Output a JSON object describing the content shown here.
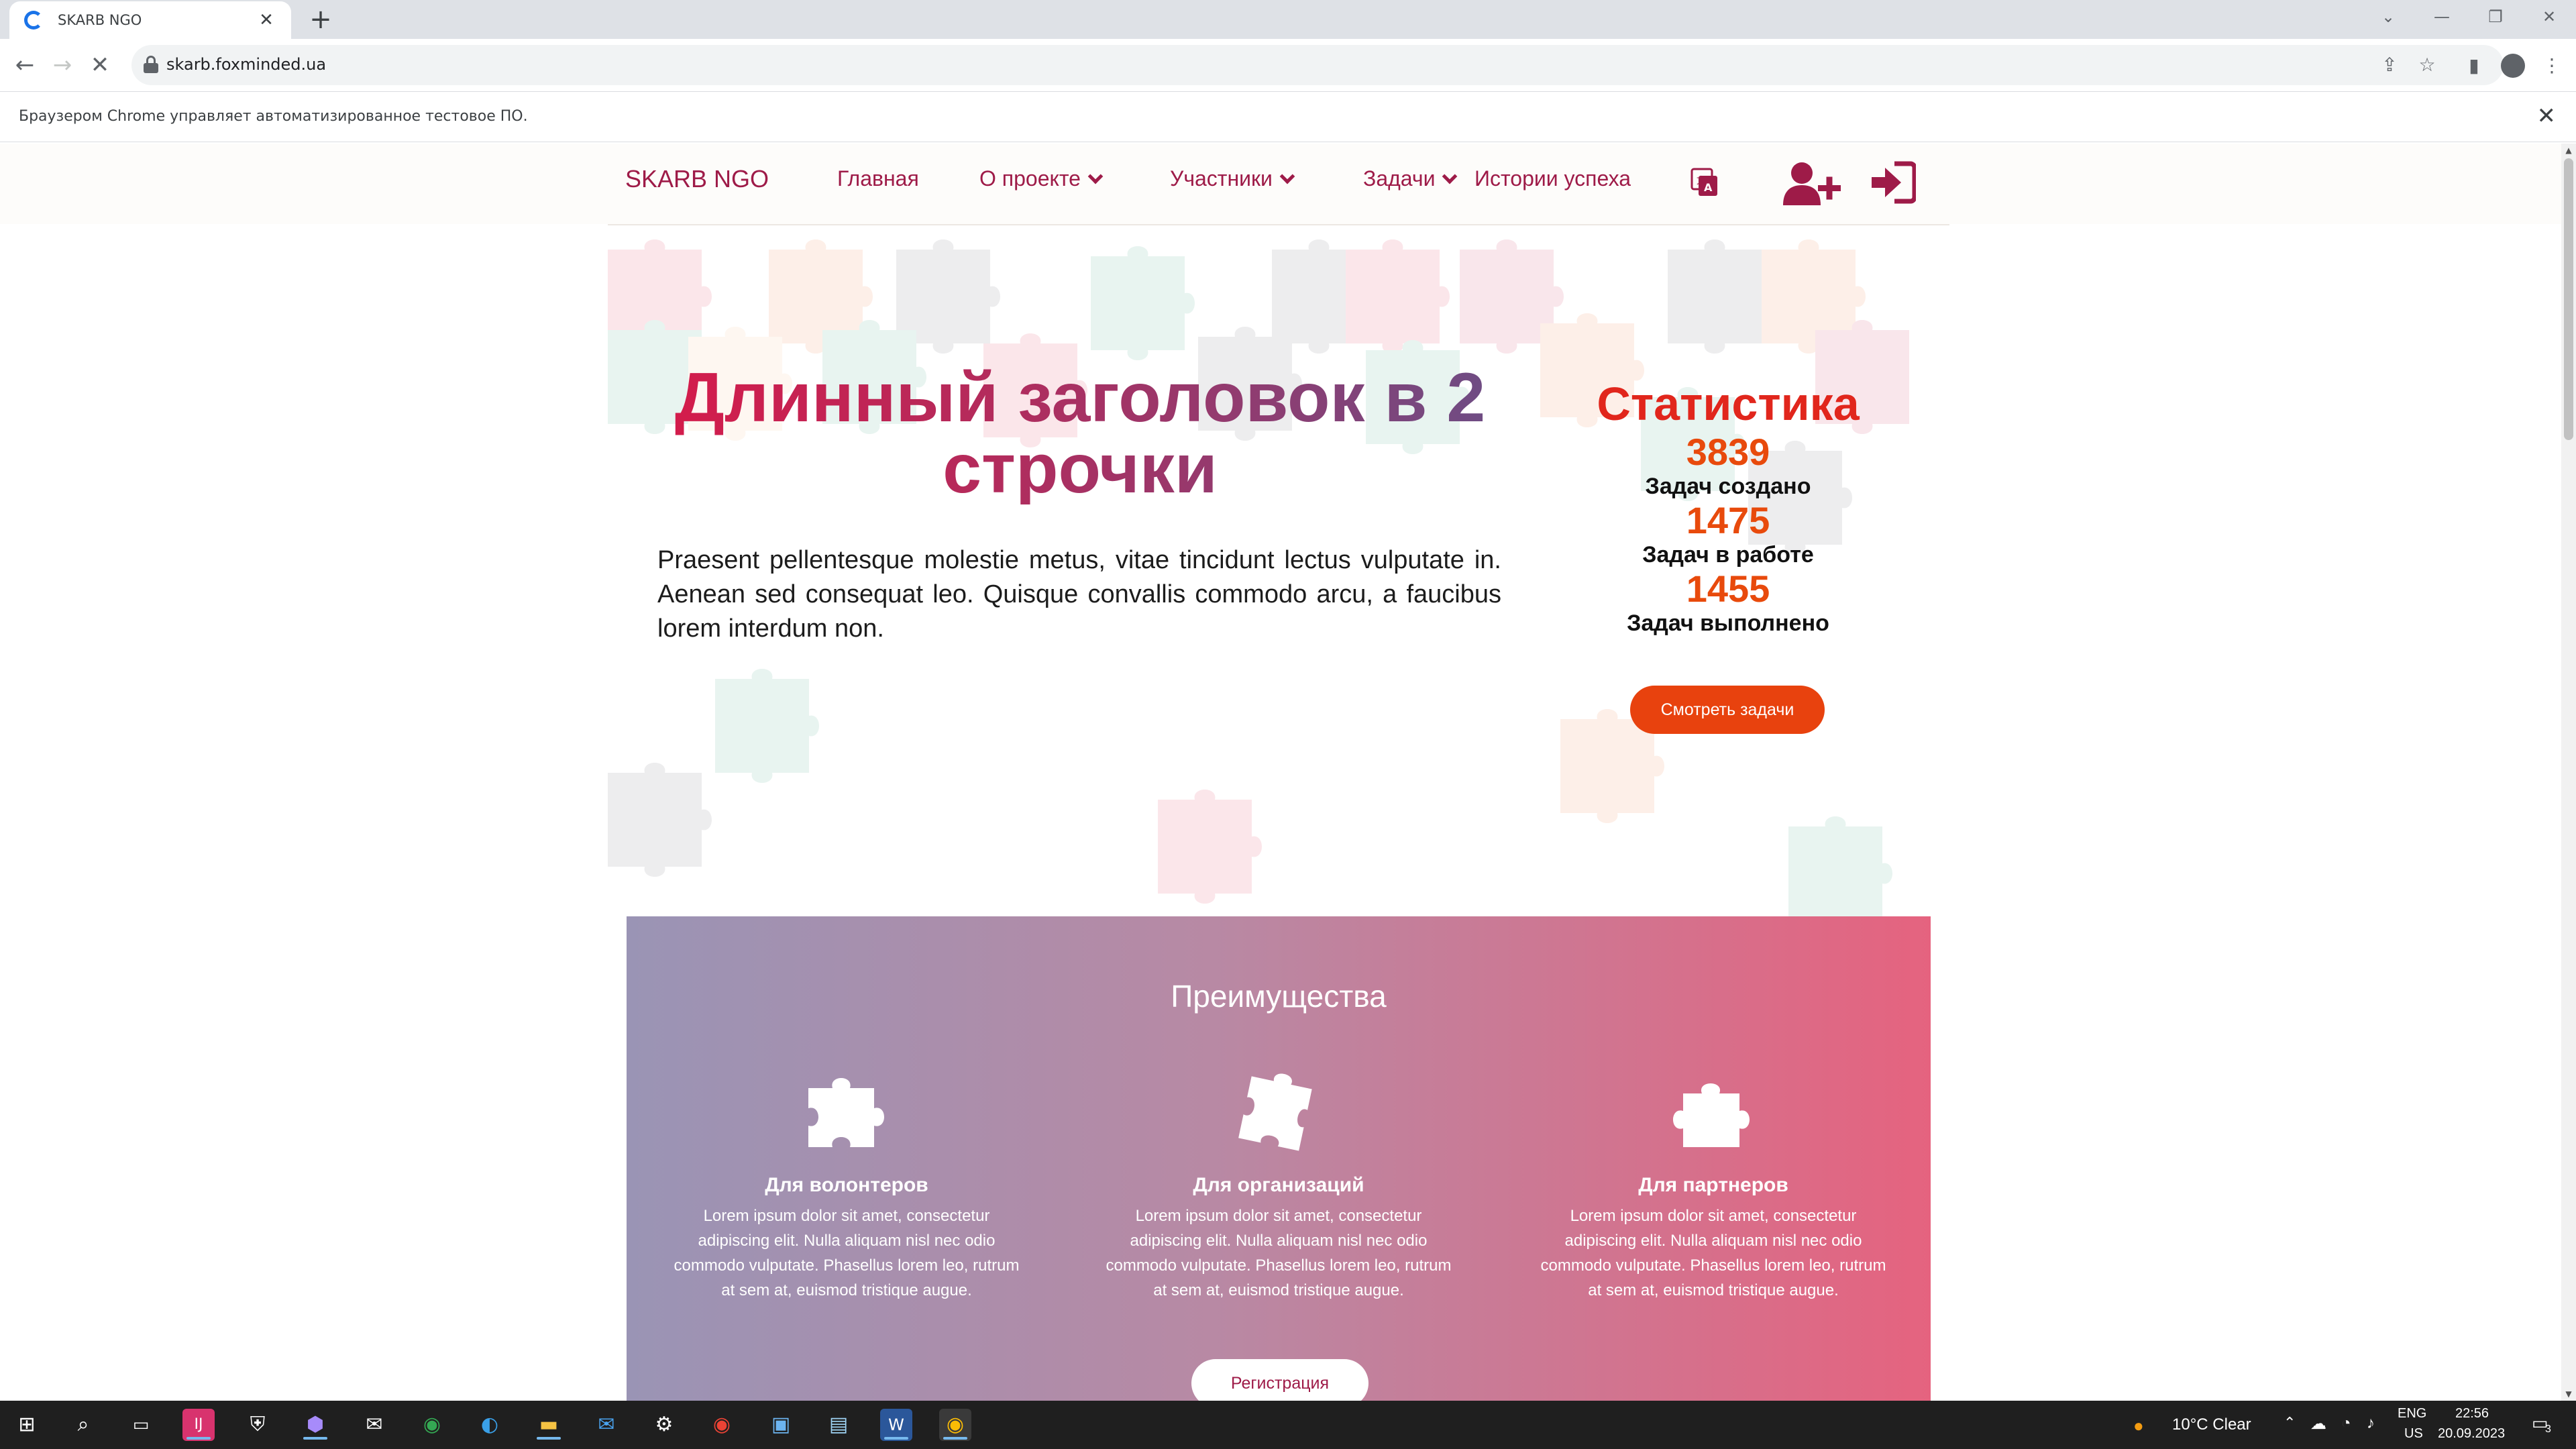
{
  "browser": {
    "tab_title": "SKARB NGO",
    "new_tab_symbol": "+",
    "url": "skarb.foxminded.ua",
    "automation_notice": "Браузером Chrome управляет автоматизированное тестовое ПО."
  },
  "site": {
    "logo": "SKARB NGO",
    "nav": {
      "home": "Главная",
      "about": "О проекте",
      "members": "Участники",
      "tasks": "Задачи",
      "stories": "Истории успеха"
    }
  },
  "hero": {
    "title": "Длинный заголовок в 2 строчки",
    "text": "Praesent pellentesque molestie metus, vitae tincidunt lectus vulputate in. Aenean sed consequat leo. Quisque convallis commodo arcu, a faucibus lorem interdum non."
  },
  "stats": {
    "title": "Статистика",
    "items": [
      {
        "value": "3839",
        "label": "Задач создано"
      },
      {
        "value": "1475",
        "label": "Задач в работе"
      },
      {
        "value": "1455",
        "label": "Задач выполнено"
      }
    ],
    "button": "Смотреть задачи"
  },
  "advantages": {
    "title": "Преимущества",
    "columns": [
      {
        "title": "Для волонтеров",
        "text": "Lorem ipsum dolor sit amet, consectetur adipiscing elit. Nulla aliquam nisl nec odio commodo vulputate. Phasellus lorem leo, rutrum at sem at, euismod tristique augue."
      },
      {
        "title": "Для организаций",
        "text": "Lorem ipsum dolor sit amet, consectetur adipiscing elit. Nulla aliquam nisl nec odio commodo vulputate. Phasellus lorem leo, rutrum at sem at, euismod tristique augue."
      },
      {
        "title": "Для партнеров",
        "text": "Lorem ipsum dolor sit amet, consectetur adipiscing elit. Nulla aliquam nisl nec odio commodo vulputate. Phasellus lorem leo, rutrum at sem at, euismod tristique augue."
      }
    ],
    "register_button": "Регистрация"
  },
  "taskbar": {
    "weather": "10°C  Clear",
    "lang_top": "ENG",
    "lang_bottom": "US",
    "time": "22:56",
    "date": "20.09.2023",
    "notification_count": "3"
  },
  "colors": {
    "brand": "#9e1b48",
    "accent": "#e8420e",
    "stats_title": "#e1261c"
  }
}
